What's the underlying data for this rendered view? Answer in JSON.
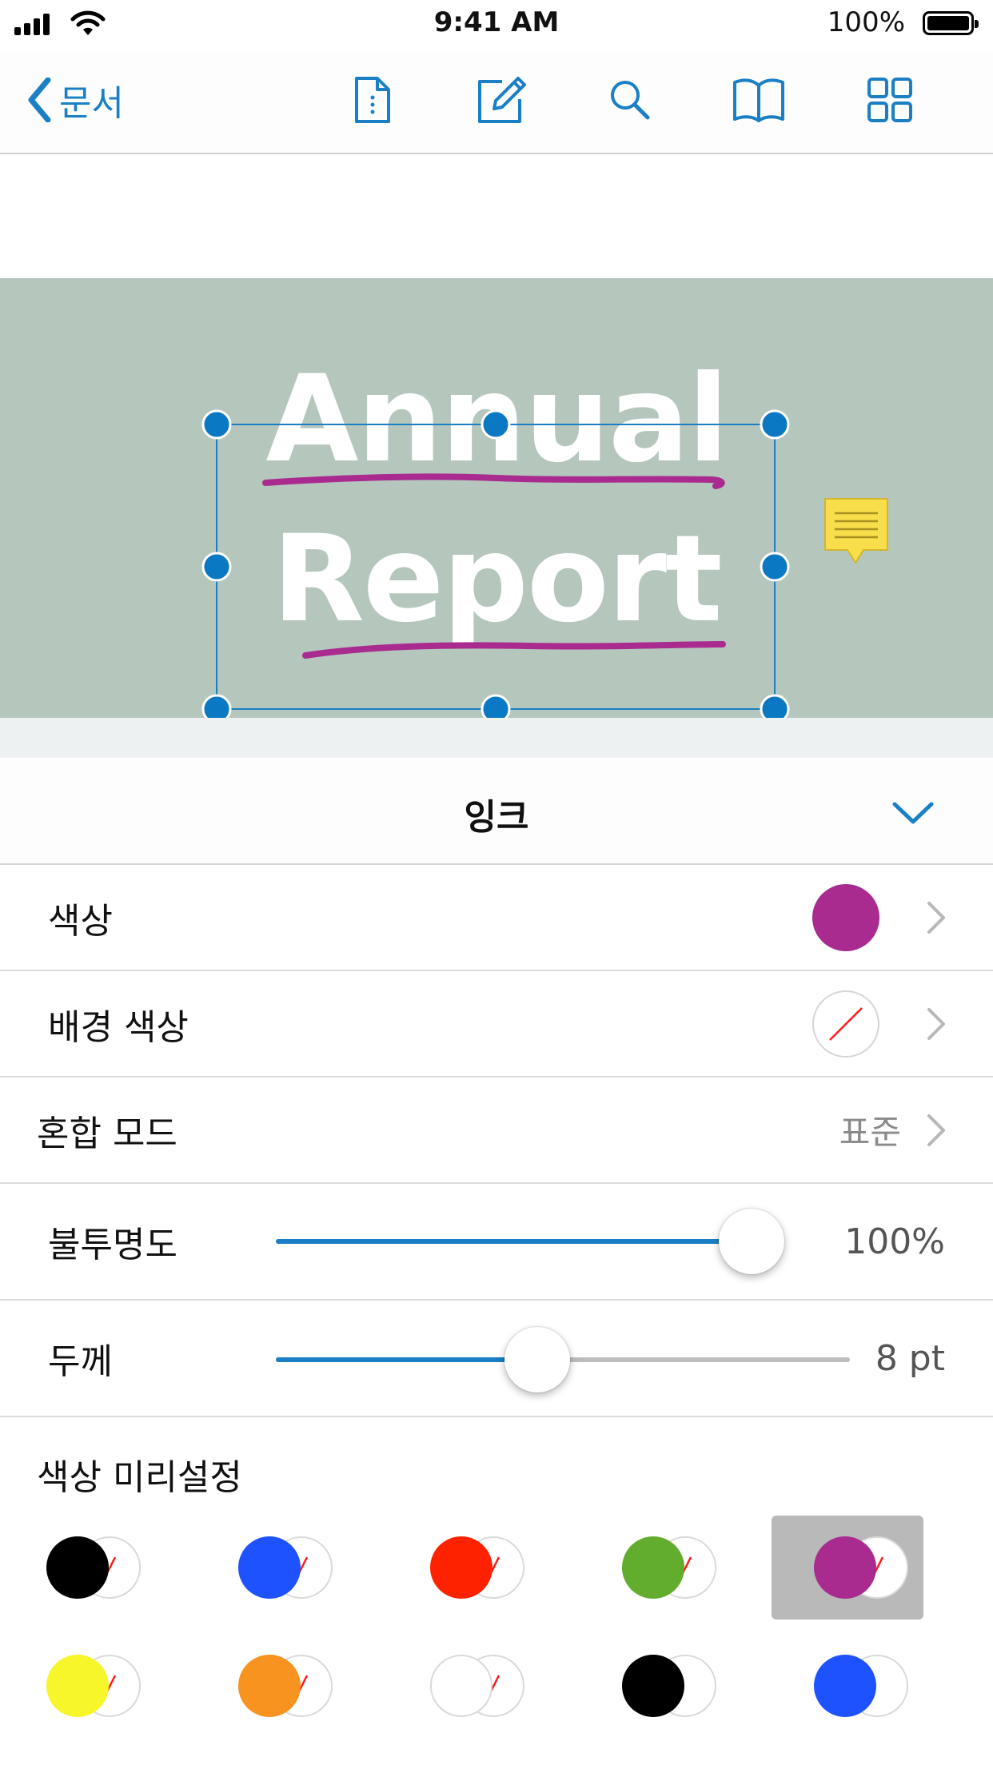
{
  "status_bar": {
    "time": "9:41 AM",
    "battery": "100%"
  },
  "nav": {
    "back_label": "문서",
    "icons": [
      "document-icon",
      "edit-icon",
      "search-icon",
      "book-icon",
      "grid-icon"
    ]
  },
  "document": {
    "title_line1": "Annual",
    "title_line2": "Report"
  },
  "colors": {
    "accent": "#1a7fc4",
    "ink": "#a92b8f",
    "page_bg": "#b5c6bd",
    "note_yellow": "#f7de4a"
  },
  "panel": {
    "title": "잉크",
    "color_label": "색상",
    "color_value": "#a92b8f",
    "bg_color_label": "배경 색상",
    "blend_label": "혼합 모드",
    "blend_value": "표준",
    "opacity_label": "불투명도",
    "opacity_value": "100%",
    "opacity_fraction": 1.0,
    "thickness_label": "두께",
    "thickness_value": "8 pt",
    "thickness_fraction": 0.45,
    "presets_title": "색상 미리설정"
  },
  "presets": [
    {
      "color": "#000000",
      "bg": "none",
      "selected": false
    },
    {
      "color": "#1f52ff",
      "bg": "none",
      "selected": false
    },
    {
      "color": "#ff2200",
      "bg": "none",
      "selected": false
    },
    {
      "color": "#63ad2e",
      "bg": "none",
      "selected": false
    },
    {
      "color": "#a92b8f",
      "bg": "none",
      "selected": true
    },
    {
      "color": "#f6f62a",
      "bg": "none",
      "selected": false
    },
    {
      "color": "#f7931e",
      "bg": "none",
      "selected": false
    },
    {
      "color": "#ffffff",
      "bg": "none",
      "selected": false
    },
    {
      "color": "#000000",
      "bg": "#ffffff",
      "selected": false
    },
    {
      "color": "#1f52ff",
      "bg": "#ffffff",
      "selected": false
    }
  ]
}
